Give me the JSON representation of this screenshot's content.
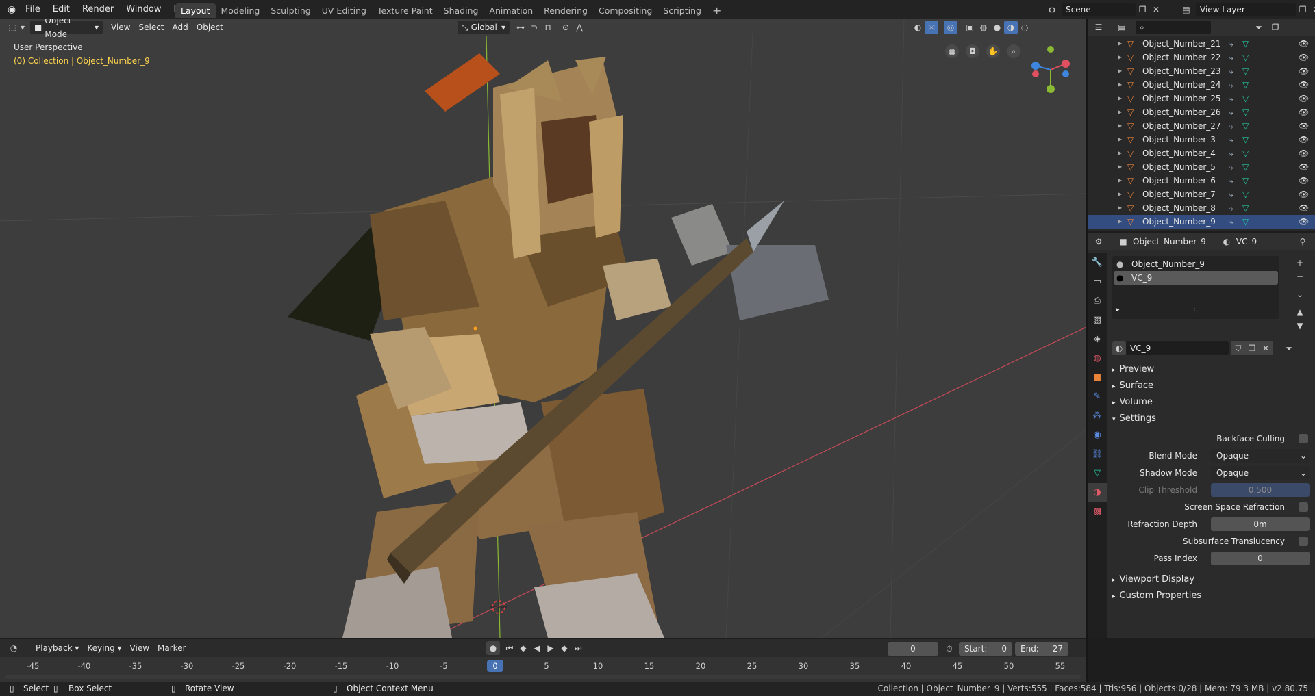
{
  "menu": [
    "File",
    "Edit",
    "Render",
    "Window",
    "Help"
  ],
  "workspaces": [
    "Layout",
    "Modeling",
    "Sculpting",
    "UV Editing",
    "Texture Paint",
    "Shading",
    "Animation",
    "Rendering",
    "Compositing",
    "Scripting"
  ],
  "active_workspace": "Layout",
  "scene": "Scene",
  "view_layer": "View Layer",
  "viewport": {
    "mode": "Object Mode",
    "menus": [
      "View",
      "Select",
      "Add",
      "Object"
    ],
    "orientation": "Global",
    "perspective_label": "User Perspective",
    "collection_label": "(0) Collection | Object_Number_9"
  },
  "outliner": {
    "items": [
      "Object_Number_21",
      "Object_Number_22",
      "Object_Number_23",
      "Object_Number_24",
      "Object_Number_25",
      "Object_Number_26",
      "Object_Number_27",
      "Object_Number_3",
      "Object_Number_4",
      "Object_Number_5",
      "Object_Number_6",
      "Object_Number_7",
      "Object_Number_8",
      "Object_Number_9"
    ],
    "selected": "Object_Number_9"
  },
  "properties": {
    "object_name": "Object_Number_9",
    "material_name": "VC_9",
    "slots": [
      "Object_Number_9",
      "VC_9"
    ],
    "material_field": "VC_9",
    "panels": {
      "preview": "Preview",
      "surface": "Surface",
      "volume": "Volume",
      "settings": "Settings",
      "viewport_display": "Viewport Display",
      "custom_properties": "Custom Properties"
    },
    "settings": {
      "backface_culling": "Backface Culling",
      "blend_mode_label": "Blend Mode",
      "blend_mode": "Opaque",
      "shadow_mode_label": "Shadow Mode",
      "shadow_mode": "Opaque",
      "clip_threshold_label": "Clip Threshold",
      "clip_threshold": "0.500",
      "ssr": "Screen Space Refraction",
      "refraction_depth_label": "Refraction Depth",
      "refraction_depth": "0m",
      "subsurface": "Subsurface Translucency",
      "pass_index_label": "Pass Index",
      "pass_index": "0"
    }
  },
  "timeline": {
    "menus": [
      "Playback",
      "Keying",
      "View",
      "Marker"
    ],
    "current_frame": "0",
    "start_label": "Start:",
    "start": "0",
    "end_label": "End:",
    "end": "27",
    "ruler": [
      "-45",
      "-40",
      "-35",
      "-30",
      "-25",
      "-20",
      "-15",
      "-10",
      "-5",
      "0",
      "5",
      "10",
      "15",
      "20",
      "25",
      "30",
      "35",
      "40",
      "45",
      "50",
      "55"
    ]
  },
  "statusbar": {
    "select": "Select",
    "box_select": "Box Select",
    "rotate_view": "Rotate View",
    "context_menu": "Object Context Menu",
    "stats": "Collection | Object_Number_9 | Verts:555 | Faces:584 | Tris:956 | Objects:0/28 | Mem: 79.3 MB | v2.80.75"
  },
  "colors": {
    "accent": "#4772b3",
    "selected_row": "#334d80",
    "label_yellow": "#ffd54f",
    "x_axis": "#e05060",
    "y_axis": "#8ab933",
    "z_axis": "#3d86e0",
    "mesh_icon": "#e8843a",
    "data_icon": "#22c7a0"
  }
}
